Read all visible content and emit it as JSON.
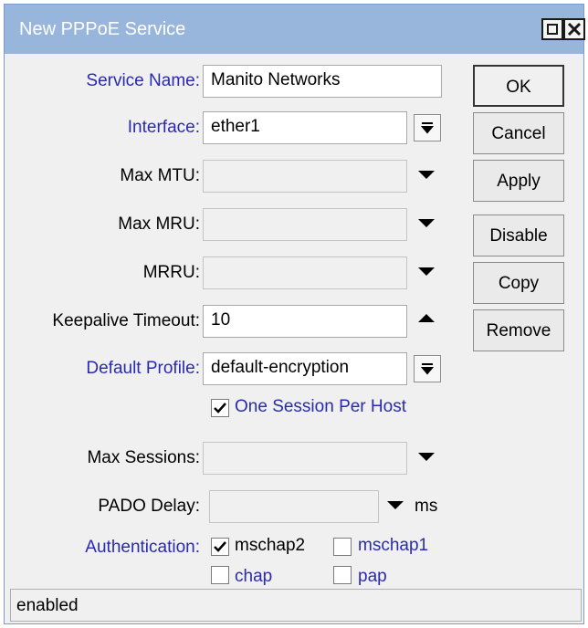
{
  "window": {
    "title": "New PPPoE Service"
  },
  "form": {
    "service_name": {
      "label": "Service Name:",
      "value": "Manito Networks"
    },
    "interface": {
      "label": "Interface:",
      "value": "ether1"
    },
    "max_mtu": {
      "label": "Max MTU:",
      "value": ""
    },
    "max_mru": {
      "label": "Max MRU:",
      "value": ""
    },
    "mrru": {
      "label": "MRRU:",
      "value": ""
    },
    "keepalive_timeout": {
      "label": "Keepalive Timeout:",
      "value": "10"
    },
    "default_profile": {
      "label": "Default Profile:",
      "value": "default-encryption"
    },
    "one_session_per_host": {
      "label": "One Session Per Host",
      "checked": true
    },
    "max_sessions": {
      "label": "Max Sessions:",
      "value": ""
    },
    "pado_delay": {
      "label": "PADO Delay:",
      "value": "",
      "unit": "ms"
    },
    "authentication": {
      "label": "Authentication:",
      "options": [
        {
          "label": "mschap2",
          "checked": true
        },
        {
          "label": "mschap1",
          "checked": false
        },
        {
          "label": "chap",
          "checked": false
        },
        {
          "label": "pap",
          "checked": false
        }
      ]
    }
  },
  "buttons": {
    "ok": "OK",
    "cancel": "Cancel",
    "apply": "Apply",
    "disable": "Disable",
    "copy": "Copy",
    "remove": "Remove"
  },
  "status": "enabled",
  "colors": {
    "titlebar": "#98b6dc",
    "link_label": "#2a2ab0",
    "window_bg": "#f0f0f0"
  }
}
